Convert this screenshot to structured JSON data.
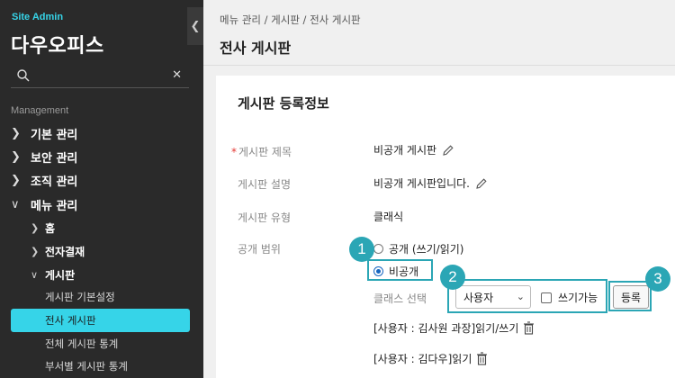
{
  "sidebar": {
    "site_admin": "Site Admin",
    "brand": "다우오피스",
    "collapse_icon": "chevron-left-icon",
    "search_placeholder": "",
    "section": "Management",
    "items": [
      {
        "label": "기본 관리",
        "icon": "chevron-right-icon"
      },
      {
        "label": "보안 관리",
        "icon": "chevron-right-icon"
      },
      {
        "label": "조직 관리",
        "icon": "chevron-right-icon"
      },
      {
        "label": "메뉴 관리",
        "icon": "chevron-down-icon"
      }
    ],
    "sub_items": [
      {
        "label": "홈",
        "icon": "chevron-right-icon"
      },
      {
        "label": "전자결재",
        "icon": "chevron-right-icon"
      },
      {
        "label": "게시판",
        "icon": "chevron-down-icon"
      }
    ],
    "leaves": [
      "게시판 기본설정",
      "전사 게시판",
      "전체 게시판 통계",
      "부서별 게시판 통계"
    ],
    "active_leaf": "전사 게시판",
    "accent_color": "#36d4e8"
  },
  "header": {
    "breadcrumb": "메뉴 관리 / 게시판 / 전사 게시판",
    "title": "전사 게시판"
  },
  "form": {
    "section_title": "게시판 등록정보",
    "required_mark": "*",
    "name_label": "게시판 제목",
    "name_value": "비공개 게시판",
    "desc_label": "게시판 설명",
    "desc_value": "비공개 게시판입니다.",
    "type_label": "게시판 유형",
    "type_value": "클래식",
    "scope_label": "공개 범위",
    "scope_options": [
      "공개 (쓰기/읽기)",
      "비공개"
    ],
    "scope_selected": "비공개",
    "class_label": "클래스 선택",
    "class_select_value": "사용자",
    "writable_label": "쓰기가능",
    "register_button": "등록",
    "permissions": [
      "[사용자 : 김사원 과장]읽기/쓰기",
      "[사용자 : 김다우]읽기"
    ]
  },
  "annotations": {
    "badges": [
      "1",
      "2",
      "3"
    ],
    "color": "#2ba6b5"
  }
}
